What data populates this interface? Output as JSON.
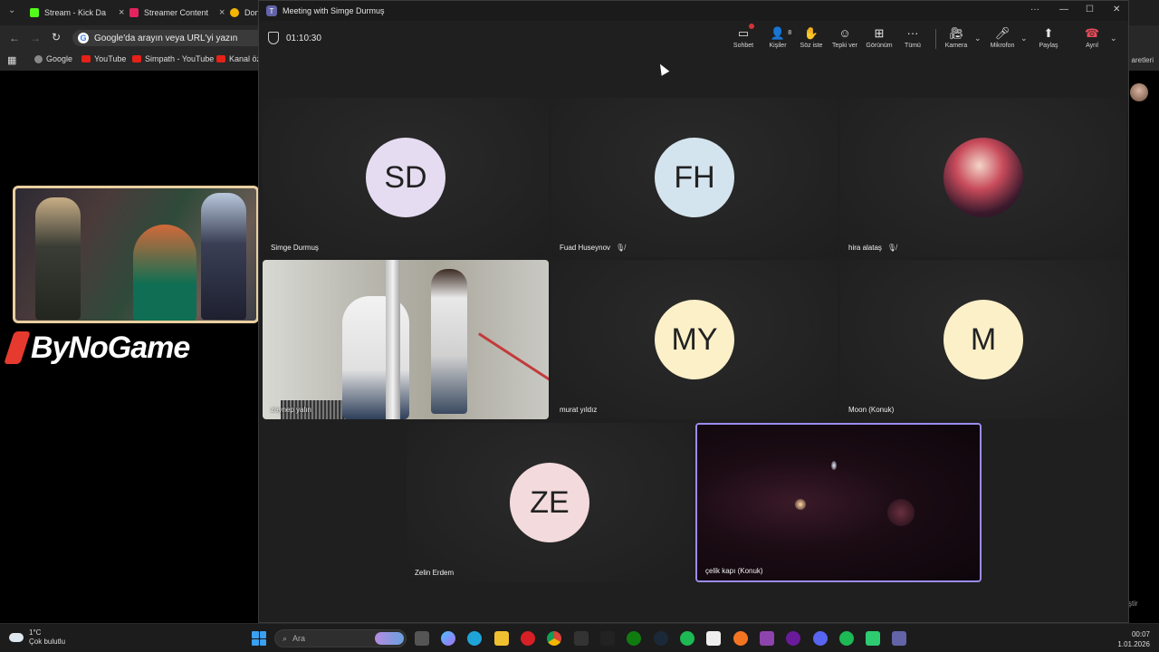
{
  "browser": {
    "tabs": [
      {
        "label": "Stream - Kick Da",
        "color": "#53fc18"
      },
      {
        "label": "Streamer Content",
        "color": "#e3245f"
      },
      {
        "label": "Don",
        "color": "#f4b400"
      }
    ],
    "omnibox_placeholder": "Google'da arayın veya URL'yi yazın",
    "bookmarks": [
      "Google",
      "YouTube",
      "Simpath - YouTube",
      "Kanal öze"
    ],
    "right_peek_text": "aretleri",
    "right_peek_button": "ştir"
  },
  "stream_overlay": {
    "brand": "ByNoGame"
  },
  "meeting": {
    "window_title": "Meeting with Simge Durmuş",
    "timer": "01:10:30",
    "toolbar": {
      "chat": "Sohbet",
      "people": "Kişiler",
      "people_count": "8",
      "raise": "Söz iste",
      "react": "Tepki ver",
      "view": "Görünüm",
      "more": "Tümü",
      "camera": "Kamera",
      "mic": "Mikrofon",
      "share": "Paylaş",
      "leave": "Ayrıl"
    },
    "participants": [
      {
        "name": "Simge Durmuş",
        "initials": "SD",
        "muted": false
      },
      {
        "name": "Fuad Huseynov",
        "initials": "FH",
        "muted": true
      },
      {
        "name": "hira alataş",
        "initials": "",
        "muted": true
      },
      {
        "name": "zeynep yalın",
        "initials": "",
        "muted": false
      },
      {
        "name": "murat yıldız",
        "initials": "MY",
        "muted": false
      },
      {
        "name": "Moon (Konuk)",
        "initials": "M",
        "muted": false
      },
      {
        "name": "Zelin Erdem",
        "initials": "ZE",
        "muted": false
      },
      {
        "name": "çelik kapı (Konuk)",
        "initials": "",
        "muted": false
      }
    ]
  },
  "taskbar": {
    "temperature": "1°C",
    "weather": "Çok bulutlu",
    "search_placeholder": "Ara",
    "time": "00:07",
    "date": "1.01.2026"
  }
}
